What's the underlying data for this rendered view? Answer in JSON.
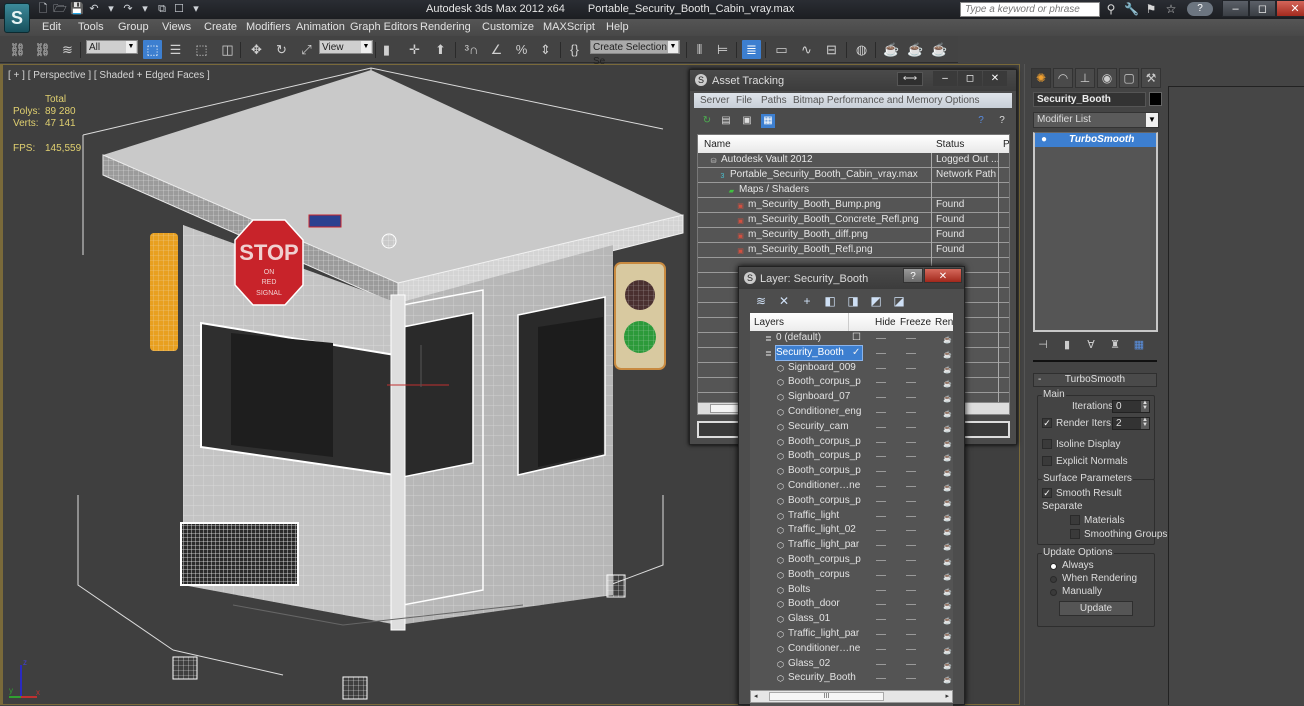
{
  "app": {
    "logo_glyph": "S",
    "title": "Autodesk 3ds Max  2012 x64",
    "filename": "Portable_Security_Booth_Cabin_vray.max",
    "search_placeholder": "Type a keyword or phrase",
    "help_glyph": "?",
    "window_controls": {
      "minimize": "–",
      "restore": "◻",
      "close": "✕"
    }
  },
  "quick_access": [
    {
      "name": "new-file",
      "glyph": "🗋"
    },
    {
      "name": "open-file",
      "glyph": "🗁"
    },
    {
      "name": "save-file",
      "glyph": "💾"
    },
    {
      "name": "undo",
      "glyph": "↶"
    },
    {
      "name": "undo-dropdown",
      "glyph": "▾"
    },
    {
      "name": "redo",
      "glyph": "↷"
    },
    {
      "name": "redo-dropdown",
      "glyph": "▾"
    },
    {
      "name": "project-folder",
      "glyph": "⧉"
    },
    {
      "name": "workspace",
      "glyph": "☐"
    },
    {
      "name": "qat-dropdown",
      "glyph": "▾"
    }
  ],
  "search_tools": [
    {
      "name": "binoculars",
      "glyph": "⚲"
    },
    {
      "name": "wrench",
      "glyph": "🔧"
    },
    {
      "name": "subscription",
      "glyph": "⚑"
    },
    {
      "name": "favorites-star",
      "glyph": "☆"
    }
  ],
  "menu": [
    "Edit",
    "Tools",
    "Group",
    "Views",
    "Create",
    "Modifiers",
    "Animation",
    "Graph Editors",
    "Rendering",
    "Customize",
    "MAXScript",
    "Help"
  ],
  "toolbar": {
    "selection_filter": "All",
    "reference_coord": "View",
    "named_selection": "Create Selection Se",
    "buttons": [
      {
        "name": "select-and-link",
        "glyph": "⛓"
      },
      {
        "name": "unlink-selection",
        "glyph": "⛓"
      },
      {
        "name": "bind-to-space-warp",
        "glyph": "≋"
      },
      {
        "name": "select-object",
        "glyph": "⬚",
        "active": true
      },
      {
        "name": "select-by-name",
        "glyph": "☰"
      },
      {
        "name": "rectangular-selection",
        "glyph": "⬚"
      },
      {
        "name": "window-crossing",
        "glyph": "◫"
      },
      {
        "name": "select-and-move",
        "glyph": "✥"
      },
      {
        "name": "select-and-rotate",
        "glyph": "↻"
      },
      {
        "name": "select-and-scale",
        "glyph": "⤢"
      },
      {
        "name": "use-pivot-center",
        "glyph": "▮"
      },
      {
        "name": "select-and-manipulate",
        "glyph": "✛"
      },
      {
        "name": "keyboard-shortcut-override",
        "glyph": "⬆"
      },
      {
        "name": "snaps-toggle",
        "glyph": "³∩"
      },
      {
        "name": "angle-snap",
        "glyph": "∠"
      },
      {
        "name": "percent-snap",
        "glyph": "%"
      },
      {
        "name": "spinner-snap",
        "glyph": "⇕"
      },
      {
        "name": "edit-named-selection",
        "glyph": "{}"
      },
      {
        "name": "mirror",
        "glyph": "⫴"
      },
      {
        "name": "align",
        "glyph": "⊨"
      },
      {
        "name": "layer-manager",
        "glyph": "≣",
        "active": true
      },
      {
        "name": "graphite-toolkit",
        "glyph": "▭"
      },
      {
        "name": "curve-editor",
        "glyph": "∿"
      },
      {
        "name": "schematic-view",
        "glyph": "⊟"
      },
      {
        "name": "material-editor",
        "glyph": "◍"
      },
      {
        "name": "render-setup",
        "glyph": "☕"
      },
      {
        "name": "rendered-frame-window",
        "glyph": "☕"
      },
      {
        "name": "render-production",
        "glyph": "☕"
      }
    ]
  },
  "viewport": {
    "label": "[ + ] [ Perspective ] [ Shaded + Edged Faces ]",
    "stats": {
      "header": "Total",
      "polys_label": "Polys:",
      "polys": "89 280",
      "verts_label": "Verts:",
      "verts": "47 141",
      "fps_label": "FPS:",
      "fps": "145,559"
    },
    "sign_text": [
      "STOP",
      "ON",
      "RED",
      "SIGNAL"
    ],
    "axis": {
      "x": "x",
      "y": "y",
      "z": "z"
    }
  },
  "command_panel": {
    "tabs": [
      {
        "name": "create",
        "glyph": "✺"
      },
      {
        "name": "modify",
        "glyph": "◠"
      },
      {
        "name": "hierarchy",
        "glyph": "⊥"
      },
      {
        "name": "motion",
        "glyph": "◉"
      },
      {
        "name": "display",
        "glyph": "▢"
      },
      {
        "name": "utilities",
        "glyph": "⚒"
      }
    ],
    "object_name": "Security_Booth",
    "object_color": "#000000",
    "modifier_list": "Modifier List",
    "stack": [
      {
        "label": "TurboSmooth",
        "bulb": "💡"
      }
    ],
    "stack_tools": [
      {
        "name": "pin-stack",
        "glyph": "⊣"
      },
      {
        "name": "show-end-result",
        "glyph": "▮"
      },
      {
        "name": "make-unique",
        "glyph": "∀"
      },
      {
        "name": "remove-modifier",
        "glyph": "♜"
      },
      {
        "name": "configure-modifier-sets",
        "glyph": "▦"
      }
    ],
    "turbosmooth": {
      "title": "TurboSmooth",
      "collapse": "-",
      "main_label": "Main",
      "iterations_label": "Iterations:",
      "iterations": "0",
      "render_iters_label": "Render Iters:",
      "render_iters": "2",
      "render_iters_checked": true,
      "isoline_display": "Isoline Display",
      "isoline_checked": false,
      "explicit_normals": "Explicit Normals",
      "explicit_checked": false,
      "surface_params": "Surface Parameters",
      "smooth_result": "Smooth Result",
      "smooth_checked": true,
      "separate": "Separate",
      "materials": "Materials",
      "materials_checked": false,
      "smoothing_groups": "Smoothing Groups",
      "smoothing_checked": false,
      "update_options": "Update Options",
      "always": "Always",
      "when_rendering": "When Rendering",
      "manually": "Manually",
      "selected_update": "Always",
      "update_button": "Update"
    }
  },
  "asset_tracking": {
    "title": "Asset Tracking",
    "dock_glyph": "⟷",
    "menu": [
      "Server",
      "File",
      "Paths",
      "Bitmap Performance and Memory",
      "Options"
    ],
    "columns": [
      "Name",
      "Status",
      "P"
    ],
    "rows": [
      {
        "name": "Autodesk Vault 2012",
        "status": "Logged Out ...",
        "indent": 1,
        "icon": "vault"
      },
      {
        "name": "Portable_Security_Booth_Cabin_vray.max",
        "status": "Network Path",
        "indent": 2,
        "icon": "max-file"
      },
      {
        "name": "Maps / Shaders",
        "status": "",
        "indent": 3,
        "icon": "maps-folder"
      },
      {
        "name": "m_Security_Booth_Bump.png",
        "status": "Found",
        "indent": 4,
        "icon": "image"
      },
      {
        "name": "m_Security_Booth_Concrete_Refl.png",
        "status": "Found",
        "indent": 4,
        "icon": "image"
      },
      {
        "name": "m_Security_Booth_diff.png",
        "status": "Found",
        "indent": 4,
        "icon": "image"
      },
      {
        "name": "m_Security_Booth_Refl.png",
        "status": "Found",
        "indent": 4,
        "icon": "image"
      }
    ]
  },
  "layer_dialog": {
    "title": "Layer: Security_Booth",
    "help_glyph": "?",
    "close_glyph": "✕",
    "tools": [
      {
        "name": "create-new-layer",
        "glyph": "≋"
      },
      {
        "name": "delete-layer",
        "glyph": "✕"
      },
      {
        "name": "add-selected-to-layer",
        "glyph": "+"
      },
      {
        "name": "select-highlighted-objects",
        "glyph": "◧"
      },
      {
        "name": "select-objects-in-layer",
        "glyph": "◨"
      },
      {
        "name": "hide-unhide-all",
        "glyph": "◩"
      },
      {
        "name": "freeze-unfreeze-all",
        "glyph": "◪"
      }
    ],
    "columns": {
      "layers": "Layers",
      "hide": "Hide",
      "freeze": "Freeze",
      "render": "Ren"
    },
    "rows": [
      {
        "name": "0 (default)",
        "type": "layer",
        "indent": 1
      },
      {
        "name": "Security_Booth",
        "type": "layer",
        "indent": 1,
        "selected": true,
        "current": true
      },
      {
        "name": "Signboard_009",
        "type": "object",
        "indent": 2
      },
      {
        "name": "Booth_corpus_p",
        "type": "object",
        "indent": 2
      },
      {
        "name": "Signboard_07",
        "type": "object",
        "indent": 2
      },
      {
        "name": "Conditioner_eng",
        "type": "object",
        "indent": 2
      },
      {
        "name": "Security_cam",
        "type": "object",
        "indent": 2
      },
      {
        "name": "Booth_corpus_p",
        "type": "object",
        "indent": 2
      },
      {
        "name": "Booth_corpus_p",
        "type": "object",
        "indent": 2
      },
      {
        "name": "Booth_corpus_p",
        "type": "object",
        "indent": 2
      },
      {
        "name": "Conditioner…ne",
        "type": "object",
        "indent": 2
      },
      {
        "name": "Booth_corpus_p",
        "type": "object",
        "indent": 2
      },
      {
        "name": "Traffic_light",
        "type": "object",
        "indent": 2
      },
      {
        "name": "Traffic_light_02",
        "type": "object",
        "indent": 2
      },
      {
        "name": "Traffic_light_par",
        "type": "object",
        "indent": 2
      },
      {
        "name": "Booth_corpus_p",
        "type": "object",
        "indent": 2
      },
      {
        "name": "Booth_corpus",
        "type": "object",
        "indent": 2
      },
      {
        "name": "Bolts",
        "type": "object",
        "indent": 2
      },
      {
        "name": "Booth_door",
        "type": "object",
        "indent": 2
      },
      {
        "name": "Glass_01",
        "type": "object",
        "indent": 2
      },
      {
        "name": "Traffic_light_par",
        "type": "object",
        "indent": 2
      },
      {
        "name": "Conditioner…ne",
        "type": "object",
        "indent": 2
      },
      {
        "name": "Glass_02",
        "type": "object",
        "indent": 2
      },
      {
        "name": "Security_Booth",
        "type": "object",
        "indent": 2
      }
    ],
    "scroll_thumb": "III",
    "current_glyph": "✓",
    "unchecked_glyph": "☐"
  },
  "colors": {
    "accent_blue": "#3d7fd0",
    "stats_yellow": "#e0d070",
    "viewport_border": "#7a6a3a",
    "stop_red": "#c8232a"
  }
}
